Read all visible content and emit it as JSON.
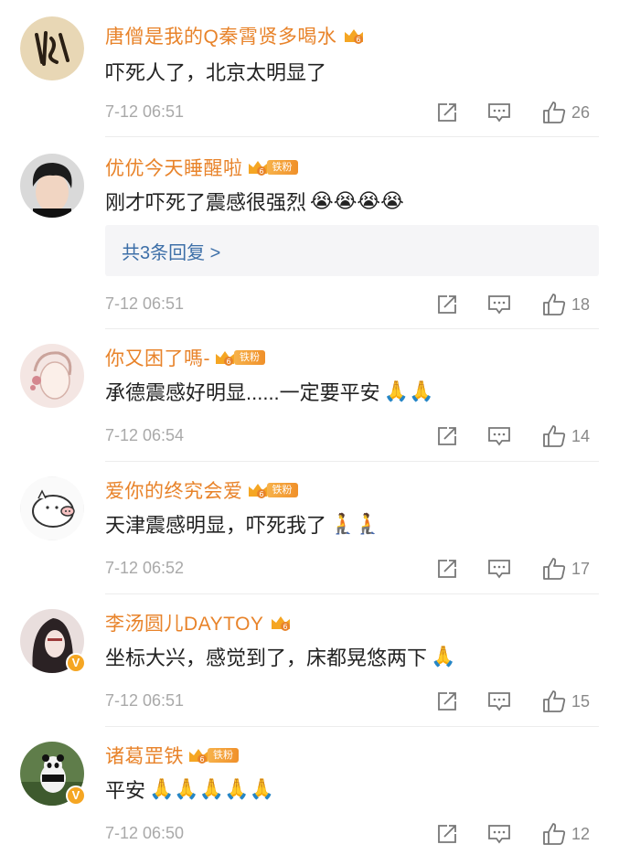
{
  "comments": [
    {
      "name": "唐僧是我的Q秦霄贤多喝水",
      "text": "吓死人了，北京太明显了",
      "time": "7-12 06:51",
      "likes": "26",
      "fan_label": "",
      "replies": "",
      "emojis": ""
    },
    {
      "name": "优优今天睡醒啦",
      "text": "刚才吓死了震感很强烈",
      "time": "7-12 06:51",
      "likes": "18",
      "fan_label": "铁粉",
      "replies": "共3条回复 >",
      "emojis": "😭😭😭😭"
    },
    {
      "name": "你又困了嗎-",
      "text": "承德震感好明显......一定要平安",
      "time": "7-12 06:54",
      "likes": "14",
      "fan_label": "铁粉",
      "replies": "",
      "emojis": "🙏🙏"
    },
    {
      "name": "爱你的终究会爱",
      "text": "天津震感明显，吓死我了",
      "time": "7-12 06:52",
      "likes": "17",
      "fan_label": "铁粉",
      "replies": "",
      "emojis": "🧎🧎"
    },
    {
      "name": "李汤圆儿DAYTOY",
      "text": "坐标大兴，感觉到了，床都晃悠两下",
      "time": "7-12 06:51",
      "likes": "15",
      "fan_label": "",
      "replies": "",
      "emojis": "🙏"
    },
    {
      "name": "诸葛罡铁",
      "text": "平安",
      "time": "7-12 06:50",
      "likes": "12",
      "fan_label": "铁粉",
      "replies": "",
      "emojis": "🙏🙏🙏🙏🙏"
    }
  ],
  "avatar_badges": {
    "v": "V"
  },
  "colors": {
    "name": "#e8832a",
    "reply_link": "#3d6fa8",
    "meta": "#a9a9a9",
    "badge": "#f5a623"
  }
}
